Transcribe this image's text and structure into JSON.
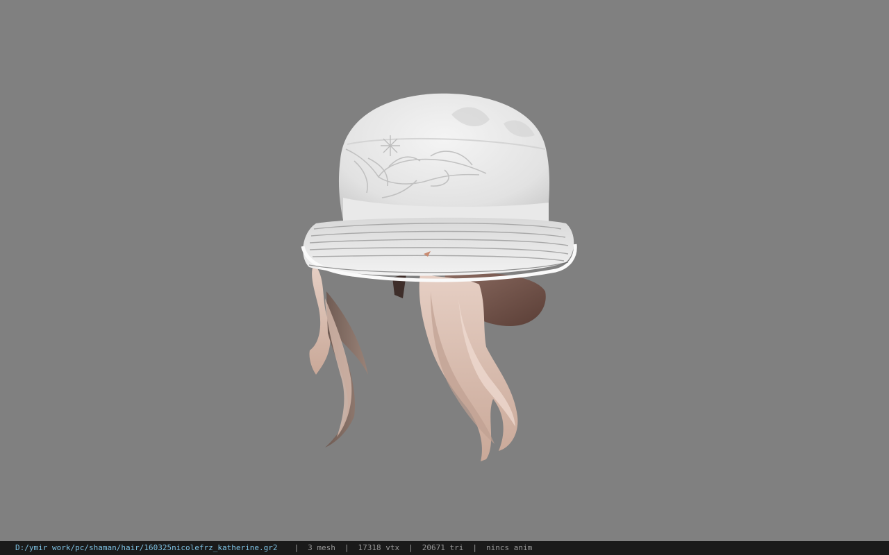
{
  "viewer": {
    "background_color": "#808080"
  },
  "model": {
    "icon": "hat-hair-model"
  },
  "status_bar": {
    "file_path": "D:/ymir work/pc/shaman/hair/160325nicolefrz_katherine.gr2",
    "separator": "|",
    "mesh_count": "3 mesh",
    "vertex_count": "17318 vtx",
    "triangle_count": "20671 tri",
    "anim_label": "nincs anim",
    "path_color": "#7fc4e6",
    "text_color": "#9a9a9a",
    "bar_color": "#1a1a1a"
  }
}
